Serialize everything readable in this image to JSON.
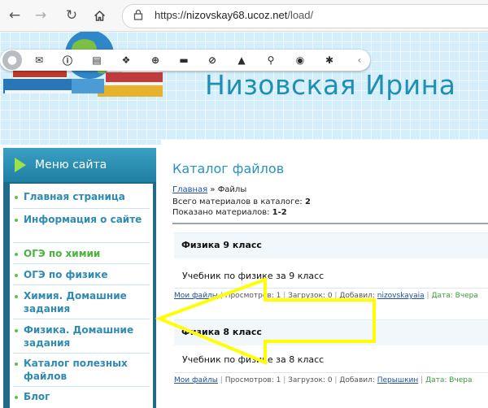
{
  "browser": {
    "url_prefix": "https://",
    "url_domain": "nizovskay68.ucoz.net",
    "url_path": "/load/"
  },
  "uzbar": {
    "icons": [
      "avatar-icon",
      "mail-icon",
      "info-icon",
      "document-icon",
      "puzzle-icon",
      "add-icon",
      "folder-icon",
      "block-icon",
      "bell-icon",
      "search-icon",
      "eye-icon",
      "gear-icon",
      "chevron-left-icon"
    ]
  },
  "header": {
    "site_title": "Низовская Ирина"
  },
  "sidebar": {
    "menu_title": "Меню сайта",
    "items": [
      {
        "label": "Главная страница"
      },
      {
        "label": "Информация о сайте"
      },
      {
        "label": "ОГЭ по химии"
      },
      {
        "label": "ОГЭ по физике"
      },
      {
        "label": "Химия. Домашние задания"
      },
      {
        "label": "Физика. Домашние задания"
      },
      {
        "label": "Каталог полезных файлов"
      },
      {
        "label": "Блог"
      }
    ]
  },
  "main": {
    "title": "Каталог файлов",
    "breadcrumb_home": "Главная",
    "breadcrumb_sep": " » ",
    "breadcrumb_current": "Файлы",
    "total_label": "Всего материалов в каталоге: ",
    "total_value": "2",
    "shown_label": "Показано материалов: ",
    "shown_value": "1-2",
    "entries": [
      {
        "title": "Физика 9 класс",
        "description": "Учебник по физике за 9 класс",
        "category": "Мои файлы",
        "views_label": "Просмотров: ",
        "views": "1",
        "downloads_label": "Загрузок: ",
        "downloads": "0",
        "added_label": "Добавил: ",
        "author": "nizovskayaia",
        "date_label": "Дата: ",
        "date": "Вчера"
      },
      {
        "title": "Физика 8 класс",
        "description": "Учебник по физике за 8 класс",
        "category": "Мои файлы",
        "views_label": "Просмотров: ",
        "views": "1",
        "downloads_label": "Загрузок: ",
        "downloads": "0",
        "added_label": "Добавил: ",
        "author": "Перышкин",
        "date_label": "Дата: ",
        "date": "Вчера"
      }
    ]
  },
  "colors": {
    "accent": "#2a91c0",
    "menu_bg": "#1f6b89",
    "arrow_overlay": "#ffff00"
  }
}
